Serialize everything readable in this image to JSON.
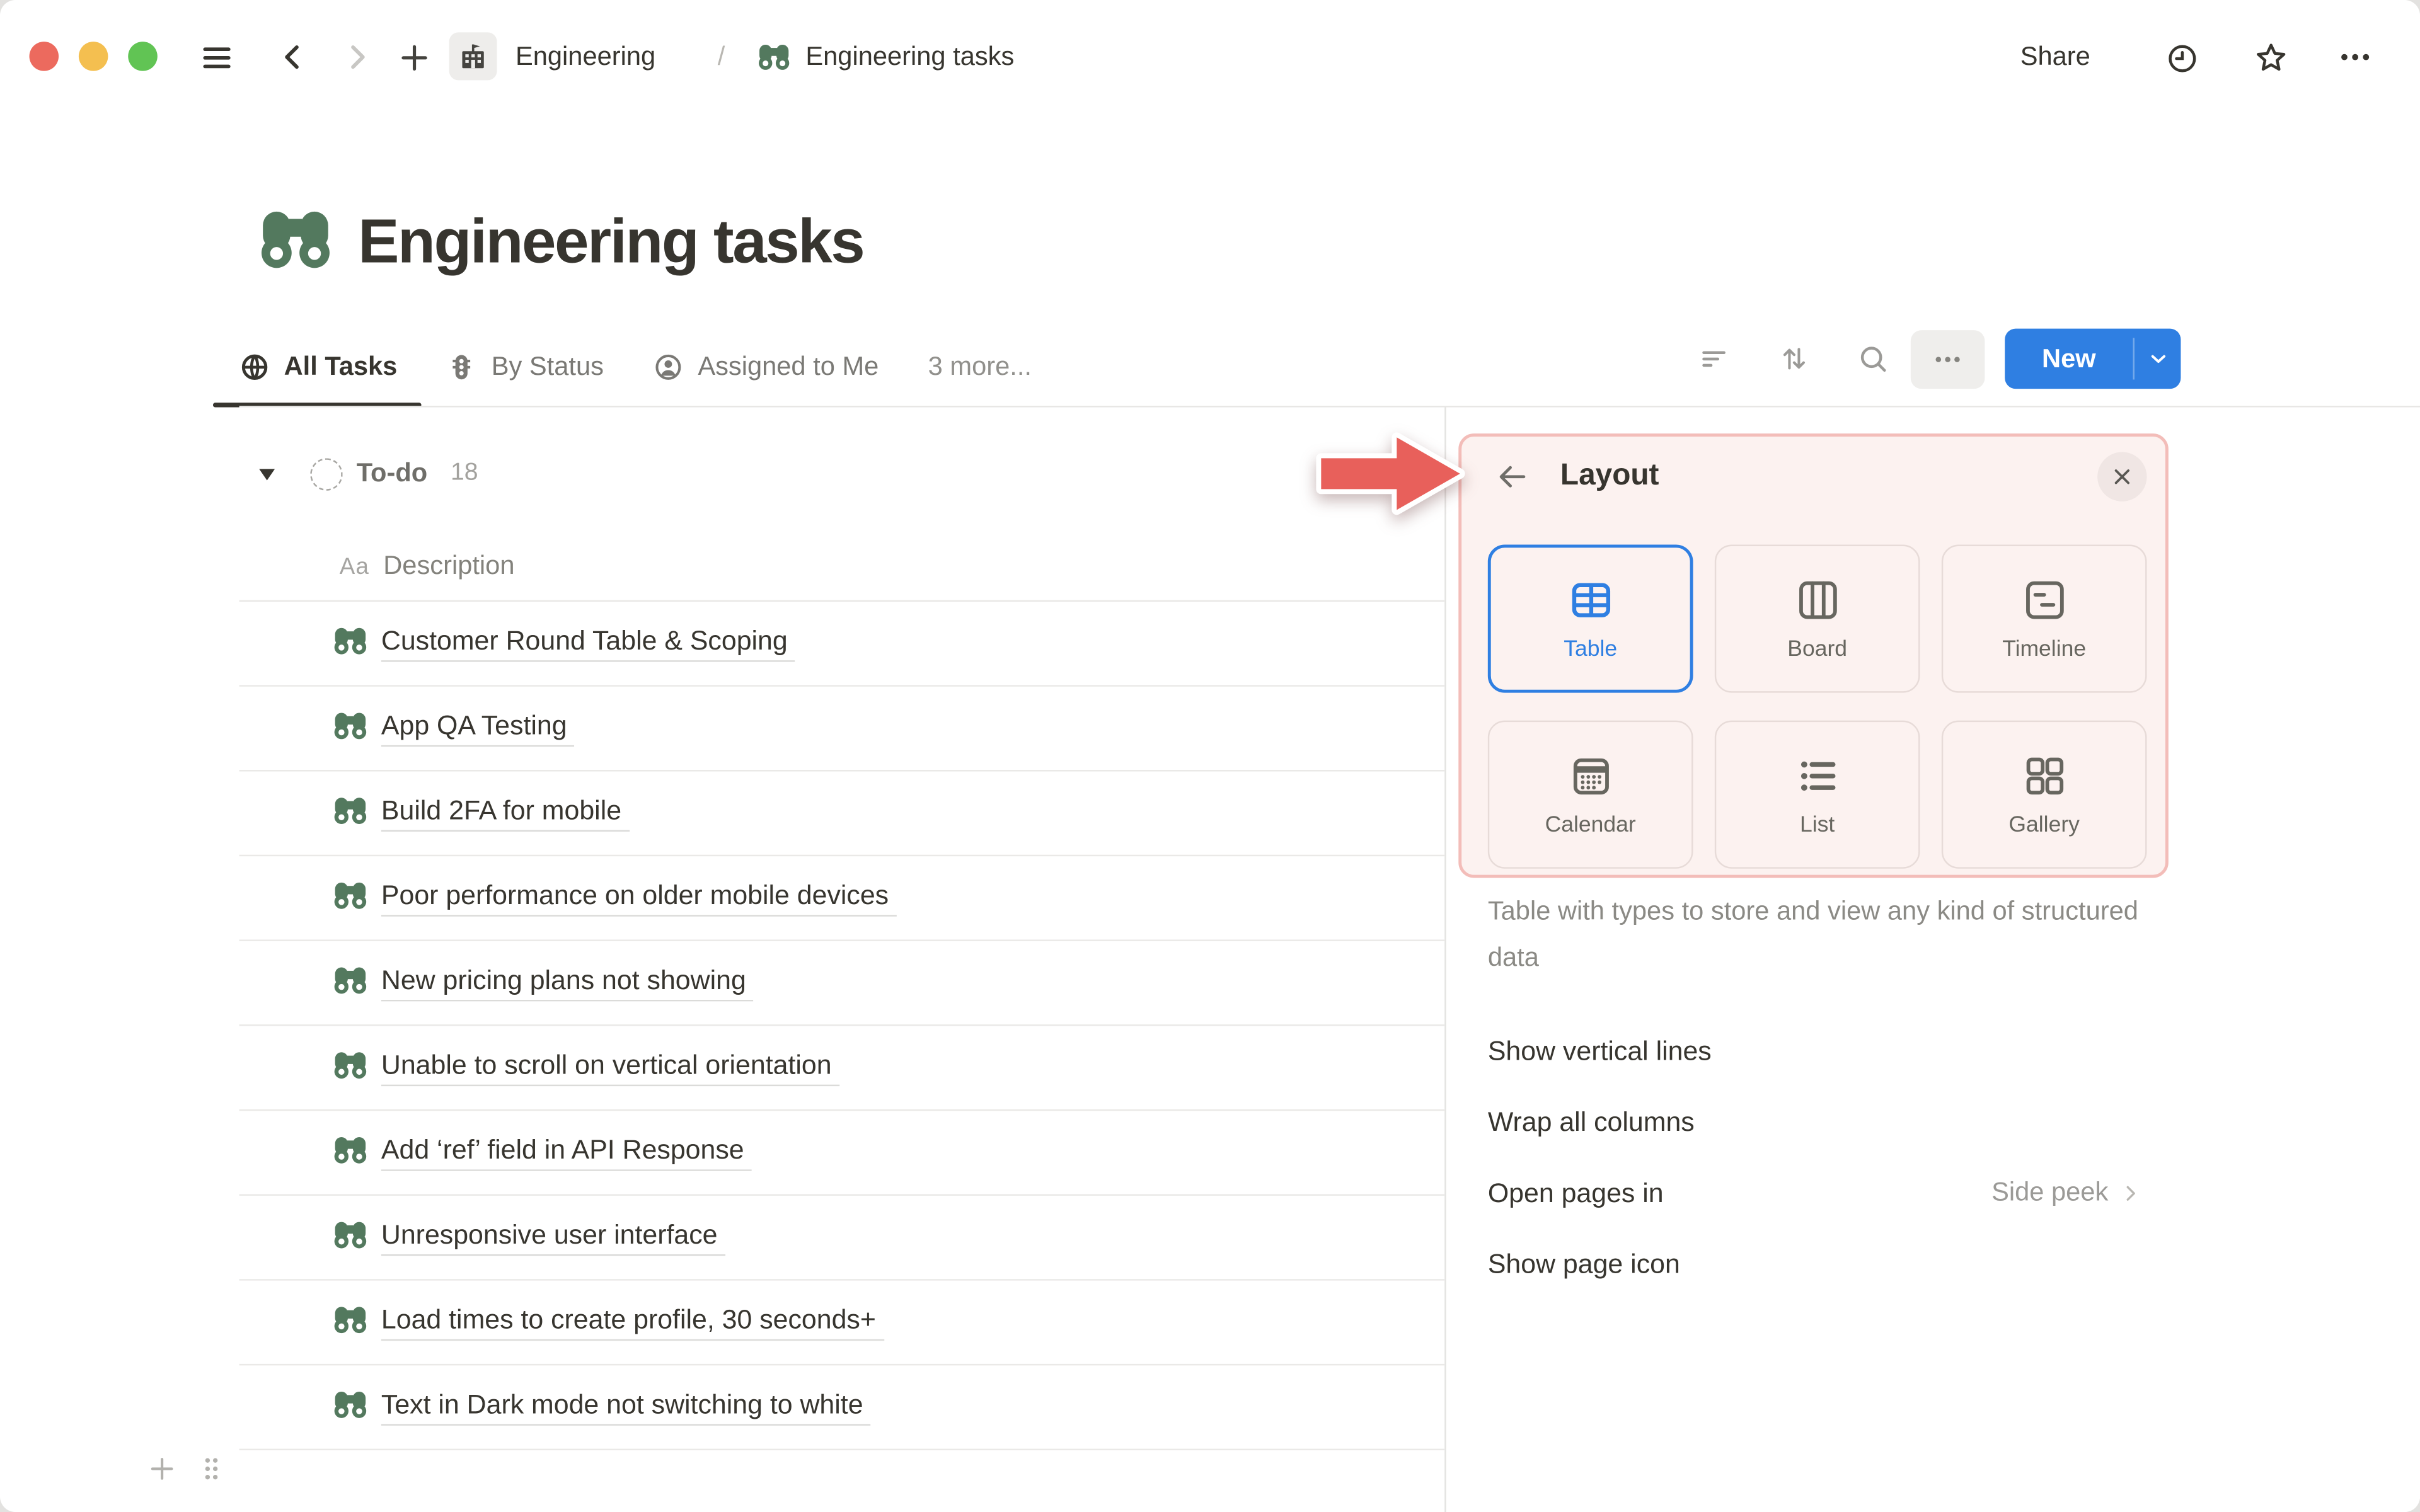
{
  "window": {
    "controls": [
      "close",
      "minimize",
      "zoom"
    ],
    "control_colors": [
      "#ec6a5e",
      "#f4bf50",
      "#61c454"
    ]
  },
  "topbar": {
    "breadcrumb": {
      "workspace_icon": "school-building",
      "workspace_label": "Engineering",
      "separator": "/",
      "page_icon": "binoculars",
      "page_label": "Engineering tasks"
    },
    "share_label": "Share"
  },
  "page": {
    "icon": "binoculars",
    "title": "Engineering tasks"
  },
  "tabs": [
    {
      "icon": "globe",
      "label": "All Tasks",
      "active": true
    },
    {
      "icon": "traffic-light",
      "label": "By Status",
      "active": false
    },
    {
      "icon": "person",
      "label": "Assigned to Me",
      "active": false
    },
    {
      "icon": null,
      "label": "3 more...",
      "active": false
    }
  ],
  "toolbar": {
    "icons": [
      "filter",
      "sort",
      "search",
      "more"
    ],
    "new_label": "New"
  },
  "table": {
    "group": {
      "name": "To-do",
      "count": "18"
    },
    "column_header": {
      "type_badge": "Aa",
      "label": "Description"
    },
    "rows": [
      "Customer Round Table & Scoping",
      "App QA Testing",
      "Build 2FA for mobile",
      "Poor performance on older mobile devices",
      "New pricing plans not showing",
      "Unable to scroll on vertical orientation",
      "Add ‘ref’ field in API Response",
      "Unresponsive user interface",
      "Load times to create profile, 30 seconds+",
      "Text in Dark mode not switching to white"
    ]
  },
  "panel": {
    "title": "Layout",
    "layouts": [
      {
        "icon": "table",
        "label": "Table",
        "selected": true
      },
      {
        "icon": "board",
        "label": "Board",
        "selected": false
      },
      {
        "icon": "timeline",
        "label": "Timeline",
        "selected": false
      },
      {
        "icon": "calendar",
        "label": "Calendar",
        "selected": false
      },
      {
        "icon": "list",
        "label": "List",
        "selected": false
      },
      {
        "icon": "gallery",
        "label": "Gallery",
        "selected": false
      }
    ],
    "description": "Table with types to store and view any kind of structured data",
    "settings": [
      {
        "label": "Show vertical lines",
        "type": "toggle",
        "value": true
      },
      {
        "label": "Wrap all columns",
        "type": "toggle",
        "value": true
      },
      {
        "label": "Open pages in",
        "type": "link",
        "value": "Side peek"
      },
      {
        "label": "Show page icon",
        "type": "toggle",
        "value": true
      }
    ]
  },
  "colors": {
    "accent_blue": "#2f7fe2",
    "highlight_bg": "#fcf2f0",
    "highlight_border": "#f3bdb9",
    "annotation_red": "#e8605b",
    "icon_green": "#53795e",
    "text_primary": "#37352f"
  }
}
